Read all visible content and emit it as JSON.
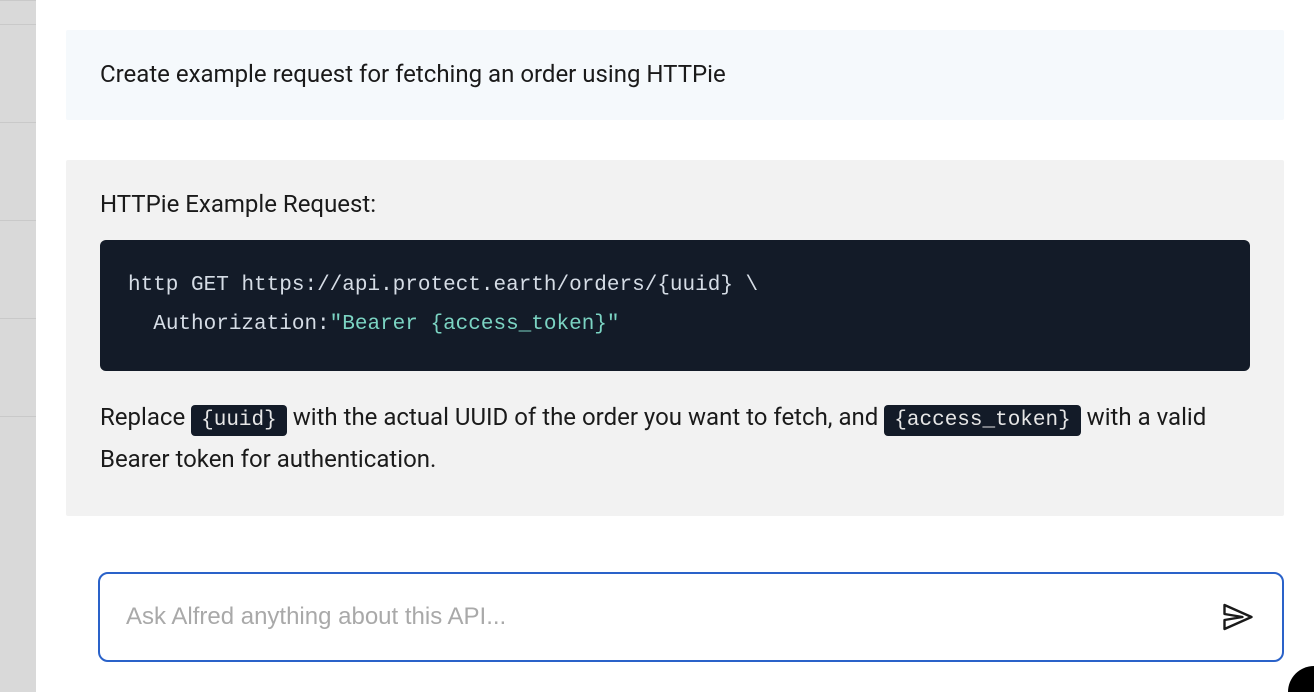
{
  "user_message": {
    "text": "Create example request for fetching an order using HTTPie"
  },
  "assistant": {
    "heading": "HTTPie Example Request:",
    "code": {
      "line1_cmd": "http",
      "line1_method": "GET",
      "line1_url": "https://api.protect.earth/orders/{uuid}",
      "line1_cont": "\\",
      "line2_header": "Authorization:",
      "line2_value": "\"Bearer {access_token}\""
    },
    "explanation": {
      "pre1": "Replace ",
      "code1": "{uuid}",
      "mid": " with the actual UUID of the order you want to fetch, and ",
      "code2": "{access_token}",
      "post": " with a valid Bearer token for authentication."
    }
  },
  "input": {
    "placeholder": "Ask Alfred anything about this API..."
  }
}
